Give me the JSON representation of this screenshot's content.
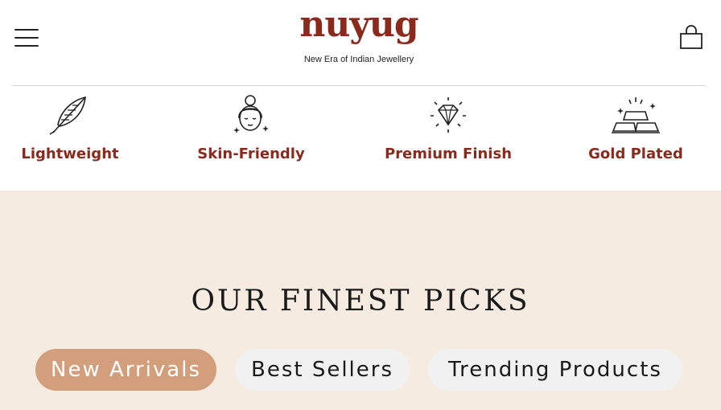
{
  "header": {
    "menu_icon": "hamburger-menu-icon",
    "logo_text": "nuyug",
    "logo_tagline": "New Era of Indian Jewellery",
    "cart_icon": "shopping-bag-icon",
    "brand_color": "#8a2a1d"
  },
  "features": [
    {
      "label": "Lightweight",
      "icon": "feather-icon"
    },
    {
      "label": "Skin-Friendly",
      "icon": "woman-face-icon"
    },
    {
      "label": "Premium Finish",
      "icon": "diamond-icon"
    },
    {
      "label": "Gold Plated",
      "icon": "gold-bars-icon"
    }
  ],
  "picks": {
    "title": "OUR FINEST PICKS",
    "background": "#f5ebe0",
    "tabs": [
      {
        "label": "New Arrivals",
        "active": true
      },
      {
        "label": "Best Sellers",
        "active": false
      },
      {
        "label": "Trending Products",
        "active": false
      }
    ],
    "active_tab_color": "#d29e7c"
  }
}
